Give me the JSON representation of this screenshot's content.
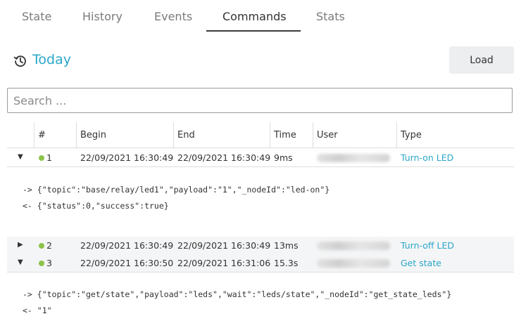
{
  "tabs": [
    {
      "label": "State"
    },
    {
      "label": "History"
    },
    {
      "label": "Events"
    },
    {
      "label": "Commands",
      "active": true
    },
    {
      "label": "Stats"
    }
  ],
  "header": {
    "icon": "history-icon",
    "title": "Today",
    "load_label": "Load"
  },
  "search": {
    "placeholder": "Search ...",
    "value": ""
  },
  "table": {
    "columns": [
      "#",
      "Begin",
      "End",
      "Time",
      "User",
      "Type"
    ],
    "rows": [
      {
        "toggle": "▼",
        "expanded": true,
        "status_color": "#8bc34a",
        "num": "1",
        "begin": "22/09/2021 16:30:49",
        "end": "22/09/2021 16:30:49",
        "time": "9ms",
        "type": "Turn-on LED",
        "request": "-> {\"topic\":\"base/relay/led1\",\"payload\":\"1\",\"_nodeId\":\"led-on\"}",
        "response": "<- {\"status\":0,\"success\":true}"
      },
      {
        "toggle": "▶",
        "expanded": false,
        "status_color": "#8bc34a",
        "num": "2",
        "begin": "22/09/2021 16:30:49",
        "end": "22/09/2021 16:30:49",
        "time": "13ms",
        "type": "Turn-off LED"
      },
      {
        "toggle": "▼",
        "expanded": true,
        "status_color": "#8bc34a",
        "num": "3",
        "begin": "22/09/2021 16:30:50",
        "end": "22/09/2021 16:31:06",
        "time": "15.3s",
        "type": "Get state",
        "request": "-> {\"topic\":\"get/state\",\"payload\":\"leds\",\"wait\":\"leds/state\",\"_nodeId\":\"get_state_leds\"}",
        "response": "<- \"1\""
      }
    ]
  },
  "colors": {
    "accent": "#2aa7c9",
    "status_ok": "#8bc34a"
  }
}
